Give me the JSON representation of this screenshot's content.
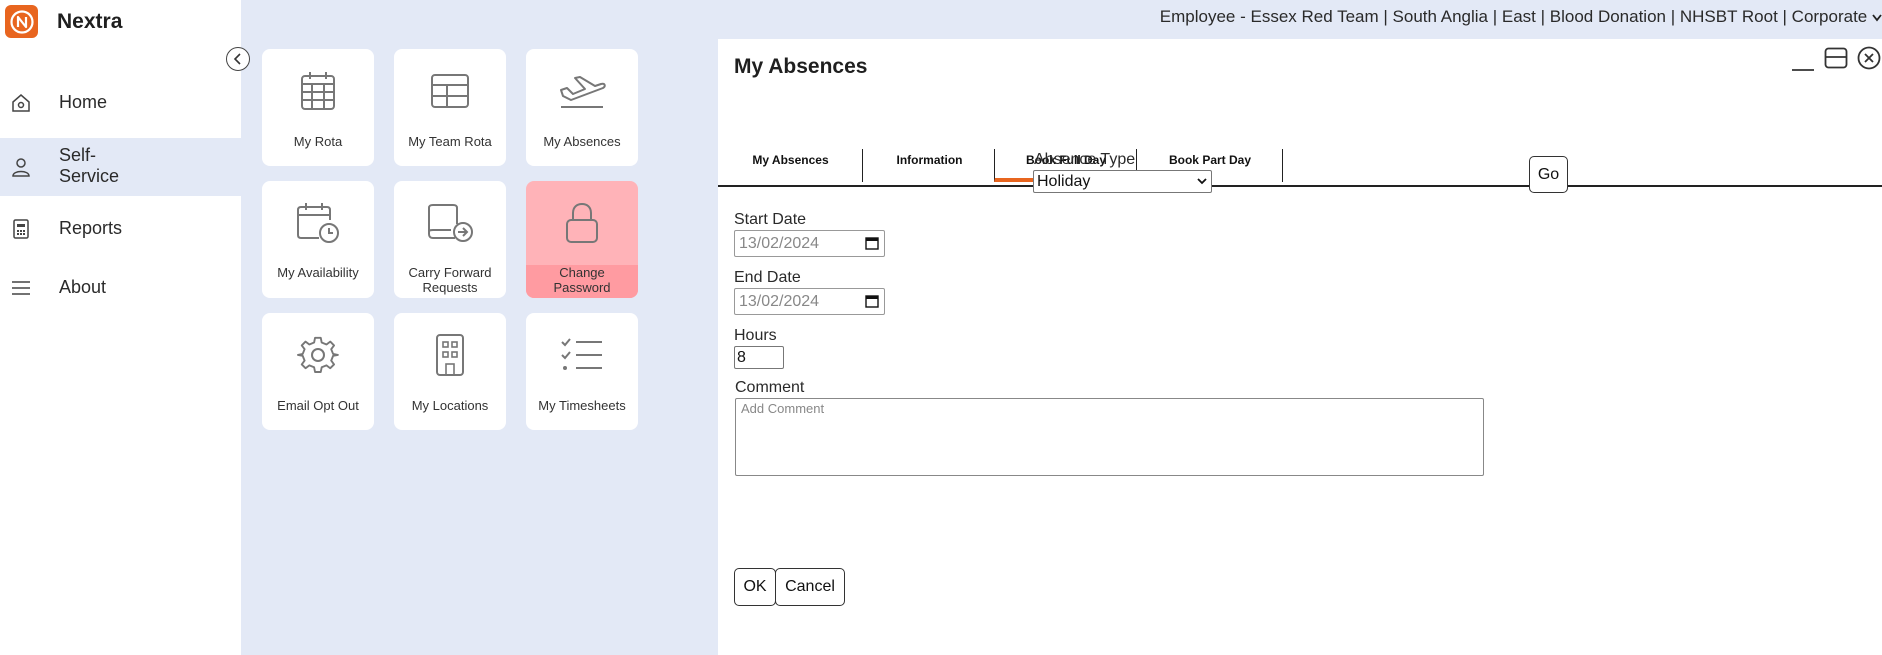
{
  "app": {
    "name": "Nextra"
  },
  "breadcrumb": {
    "text": "Employee - Essex Red Team | South Anglia | East | Blood Donation | NHSBT Root | Corporate"
  },
  "sidebar": {
    "items": [
      {
        "label": "Home",
        "icon": "home-icon"
      },
      {
        "label": "Self-Service",
        "label_line1": "Self-",
        "label_line2": "Service",
        "icon": "user-icon",
        "active": true
      },
      {
        "label": "Reports",
        "icon": "report-icon"
      },
      {
        "label": "About",
        "icon": "menu-icon"
      }
    ]
  },
  "tiles": [
    {
      "label": "My Rota",
      "icon": "calendar-grid-icon"
    },
    {
      "label": "My Team Rota",
      "icon": "table-icon"
    },
    {
      "label": "My Absences",
      "icon": "plane-icon"
    },
    {
      "label": "My Availability",
      "icon": "calendar-clock-icon"
    },
    {
      "label": "Carry Forward Requests",
      "line1": "Carry Forward",
      "line2": "Requests",
      "icon": "document-forward-icon"
    },
    {
      "label": "Change Password",
      "line1": "Change",
      "line2": "Password",
      "icon": "lock-icon",
      "highlighted": true
    },
    {
      "label": "Email Opt Out",
      "icon": "gear-icon"
    },
    {
      "label": "My Locations",
      "icon": "building-icon"
    },
    {
      "label": "My Timesheets",
      "icon": "checklist-icon"
    }
  ],
  "dialog": {
    "title": "My Absences",
    "tabs": [
      {
        "label": "My Absences"
      },
      {
        "label": "Information"
      },
      {
        "label": "Book Full Day",
        "active": true
      },
      {
        "label": "Book Part Day"
      }
    ],
    "absence_type": {
      "label": "Absence Type",
      "value": "Holiday"
    },
    "go_label": "Go",
    "start_date": {
      "label": "Start Date",
      "value": "13/02/2024"
    },
    "end_date": {
      "label": "End Date",
      "value": "13/02/2024"
    },
    "hours": {
      "label": "Hours",
      "value": "8"
    },
    "comment": {
      "label": "Comment",
      "placeholder": "Add Comment"
    },
    "ok_label": "OK",
    "cancel_label": "Cancel"
  },
  "colors": {
    "accent": "#e8651f",
    "background": "#e3e9f6",
    "highlight_tile": "#ffb3b8"
  }
}
